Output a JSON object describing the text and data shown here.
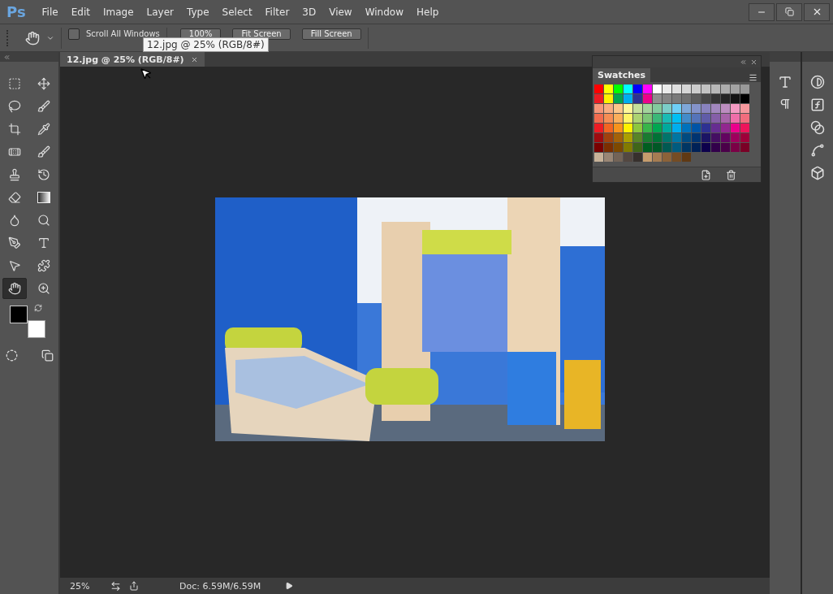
{
  "app": {
    "logo": "Ps"
  },
  "menu": [
    "File",
    "Edit",
    "Image",
    "Layer",
    "Type",
    "Select",
    "Filter",
    "3D",
    "View",
    "Window",
    "Help"
  ],
  "options_bar": {
    "scroll_all_windows": {
      "label": "Scroll All Windows",
      "checked": false
    },
    "buttons": [
      "100%",
      "Fit Screen",
      "Fill Screen"
    ]
  },
  "tooltip": "12.jpg @ 25% (RGB/8#)",
  "document_tabs": [
    {
      "label": "12.jpg @ 25% (RGB/8#)",
      "selected": true
    }
  ],
  "tools": [
    {
      "kind": "marquee",
      "selected": false
    },
    {
      "kind": "move",
      "selected": false
    },
    {
      "kind": "lasso",
      "selected": false
    },
    {
      "kind": "quick-select",
      "selected": false
    },
    {
      "kind": "crop",
      "selected": false
    },
    {
      "kind": "eyedropper",
      "selected": false
    },
    {
      "kind": "healing",
      "selected": false
    },
    {
      "kind": "brush",
      "selected": false
    },
    {
      "kind": "stamp",
      "selected": false
    },
    {
      "kind": "history-brush",
      "selected": false
    },
    {
      "kind": "eraser",
      "selected": false
    },
    {
      "kind": "gradient",
      "selected": false
    },
    {
      "kind": "blur",
      "selected": false
    },
    {
      "kind": "dodge",
      "selected": false
    },
    {
      "kind": "pen",
      "selected": false
    },
    {
      "kind": "type",
      "selected": false
    },
    {
      "kind": "path-select",
      "selected": false
    },
    {
      "kind": "shape",
      "selected": false
    },
    {
      "kind": "hand",
      "selected": true
    },
    {
      "kind": "zoom",
      "selected": false
    }
  ],
  "color_swatches": [
    {
      "kind": "foreground",
      "color": "#000000"
    },
    {
      "kind": "background",
      "color": "#ffffff"
    }
  ],
  "swatches_panel": {
    "tab": "Swatches",
    "swatches": [
      {
        "color": "#ff0000"
      },
      {
        "color": "#ffff00"
      },
      {
        "color": "#00ff00"
      },
      {
        "color": "#00ffff"
      },
      {
        "color": "#0000ff"
      },
      {
        "color": "#ff00ff"
      },
      {
        "color": "#ffffff"
      },
      {
        "color": "#ebebeb"
      },
      {
        "color": "#e0e0e0"
      },
      {
        "color": "#d6d6d6"
      },
      {
        "color": "#cccccc"
      },
      {
        "color": "#c2c2c2"
      },
      {
        "color": "#b8b8b8"
      },
      {
        "color": "#adadad"
      },
      {
        "color": "#a3a3a3"
      },
      {
        "color": "#999999"
      },
      {
        "color": "#ed1c24"
      },
      {
        "color": "#fff200"
      },
      {
        "color": "#00a651"
      },
      {
        "color": "#00aeef"
      },
      {
        "color": "#2e3192"
      },
      {
        "color": "#ec008c"
      },
      {
        "color": "#8f8f8f"
      },
      {
        "color": "#858585"
      },
      {
        "color": "#7a7a7a"
      },
      {
        "color": "#707070"
      },
      {
        "color": "#5c5c5c"
      },
      {
        "color": "#474747"
      },
      {
        "color": "#363636"
      },
      {
        "color": "#262626"
      },
      {
        "color": "#141414"
      },
      {
        "color": "#000000"
      },
      {
        "color": "#f7977a"
      },
      {
        "color": "#f9ad81"
      },
      {
        "color": "#fdc68a"
      },
      {
        "color": "#fff79a"
      },
      {
        "color": "#c4df9b"
      },
      {
        "color": "#a3d39c"
      },
      {
        "color": "#82ca9d"
      },
      {
        "color": "#7bcdc8"
      },
      {
        "color": "#6ecff6"
      },
      {
        "color": "#7ea7d8"
      },
      {
        "color": "#8493ca"
      },
      {
        "color": "#8882be"
      },
      {
        "color": "#a187be"
      },
      {
        "color": "#bc8dbf"
      },
      {
        "color": "#f49ac2"
      },
      {
        "color": "#f6989d"
      },
      {
        "color": "#f26c4f"
      },
      {
        "color": "#f68e55"
      },
      {
        "color": "#fbaf5c"
      },
      {
        "color": "#fff467"
      },
      {
        "color": "#acd372"
      },
      {
        "color": "#7cc576"
      },
      {
        "color": "#3bb878"
      },
      {
        "color": "#1abbb4"
      },
      {
        "color": "#00bff3"
      },
      {
        "color": "#438cca"
      },
      {
        "color": "#5574b9"
      },
      {
        "color": "#605ca8"
      },
      {
        "color": "#855fa8"
      },
      {
        "color": "#a763a8"
      },
      {
        "color": "#f06ea9"
      },
      {
        "color": "#f26d7d"
      },
      {
        "color": "#ed1c24"
      },
      {
        "color": "#f26522"
      },
      {
        "color": "#f7941d"
      },
      {
        "color": "#fff200"
      },
      {
        "color": "#8dc73f"
      },
      {
        "color": "#39b54a"
      },
      {
        "color": "#00a651"
      },
      {
        "color": "#00a99d"
      },
      {
        "color": "#00aeef"
      },
      {
        "color": "#0072bc"
      },
      {
        "color": "#0054a6"
      },
      {
        "color": "#2e3192"
      },
      {
        "color": "#662d91"
      },
      {
        "color": "#92278f"
      },
      {
        "color": "#ec008c"
      },
      {
        "color": "#ed145b"
      },
      {
        "color": "#9e0b0f"
      },
      {
        "color": "#a0410d"
      },
      {
        "color": "#a36209"
      },
      {
        "color": "#aba000"
      },
      {
        "color": "#598527"
      },
      {
        "color": "#1a7b30"
      },
      {
        "color": "#007236"
      },
      {
        "color": "#00746b"
      },
      {
        "color": "#0076a3"
      },
      {
        "color": "#004b80"
      },
      {
        "color": "#003471"
      },
      {
        "color": "#1b1464"
      },
      {
        "color": "#440e62"
      },
      {
        "color": "#630460"
      },
      {
        "color": "#9e005d"
      },
      {
        "color": "#9e0039"
      },
      {
        "color": "#790000"
      },
      {
        "color": "#7b2e00"
      },
      {
        "color": "#7d4900"
      },
      {
        "color": "#827b00"
      },
      {
        "color": "#406618"
      },
      {
        "color": "#005e20"
      },
      {
        "color": "#005826"
      },
      {
        "color": "#005952"
      },
      {
        "color": "#005b7f"
      },
      {
        "color": "#003663"
      },
      {
        "color": "#002157"
      },
      {
        "color": "#0d004c"
      },
      {
        "color": "#32004b"
      },
      {
        "color": "#4b0049"
      },
      {
        "color": "#7b0046"
      },
      {
        "color": "#7a0026"
      },
      {
        "color": "#c7b299"
      },
      {
        "color": "#998675"
      },
      {
        "color": "#736357"
      },
      {
        "color": "#534741"
      },
      {
        "color": "#37302d"
      },
      {
        "color": "#c69c6d"
      },
      {
        "color": "#a67c52"
      },
      {
        "color": "#8c6239"
      },
      {
        "color": "#754c24"
      },
      {
        "color": "#603913"
      }
    ]
  },
  "status_bar": {
    "zoom": "25%",
    "doc_info": "Doc: 6.59M/6.59M"
  }
}
